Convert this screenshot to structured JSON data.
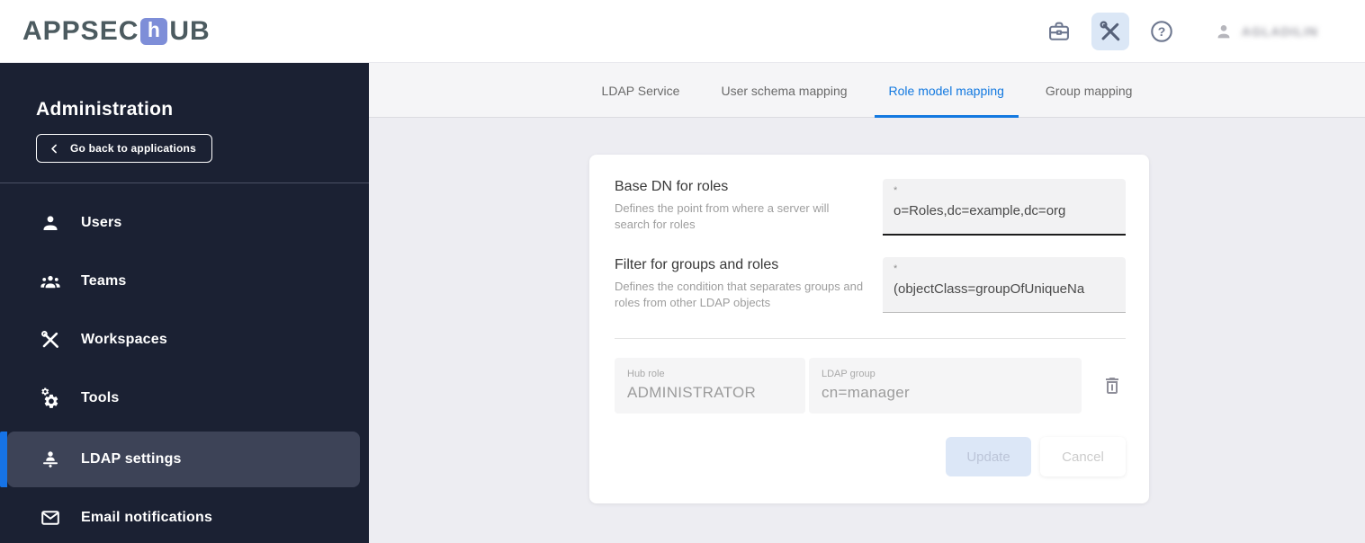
{
  "colors": {
    "accent_blue": "#1379e0",
    "sidebar_bg": "#1b2133",
    "sidebar_selected_bg": "#3d4357",
    "selected_accent_bar": "#1673e6",
    "logo_tile": "#7e8ed8",
    "logo_text": "#4c5b60",
    "page_bg": "#ededf2",
    "tabstrip_bg": "#f5f5f7",
    "input_bg": "#f2f2f3",
    "update_button_bg": "#dce7f7"
  },
  "topbar": {
    "logo": {
      "part1": "APPSEC",
      "tile_letter": "h",
      "part2": "UB"
    },
    "icons": [
      "briefcase-icon",
      "tools-icon",
      "help-icon"
    ],
    "user": {
      "name": "AGLADILIN"
    }
  },
  "sidebar": {
    "title": "Administration",
    "back_button": "Go back to applications",
    "items": [
      {
        "label": "Users",
        "icon": "person-icon",
        "selected": false
      },
      {
        "label": "Teams",
        "icon": "group-icon",
        "selected": false
      },
      {
        "label": "Workspaces",
        "icon": "construction-icon",
        "selected": false
      },
      {
        "label": "Tools",
        "icon": "gears-icon",
        "selected": false
      },
      {
        "label": "LDAP settings",
        "icon": "ldap-person-icon",
        "selected": true
      },
      {
        "label": "Email notifications",
        "icon": "mail-icon",
        "selected": false
      }
    ]
  },
  "tabs": {
    "items": [
      {
        "label": "LDAP Service",
        "active": false
      },
      {
        "label": "User schema mapping",
        "active": false
      },
      {
        "label": "Role model mapping",
        "active": true
      },
      {
        "label": "Group mapping",
        "active": false
      }
    ]
  },
  "form": {
    "fields": [
      {
        "label": "Base DN for roles",
        "description": "Defines the point from where a server will search for roles",
        "required_marker": "*",
        "value": "o=Roles,dc=example,dc=org"
      },
      {
        "label": "Filter for groups and roles",
        "description": "Defines the condition that separates groups and roles from other LDAP objects",
        "required_marker": "*",
        "value": "(objectClass=groupOfUniqueNa"
      }
    ],
    "mapping": {
      "hub_role": {
        "label": "Hub role",
        "value": "ADMINISTRATOR"
      },
      "ldap_group": {
        "label": "LDAP group",
        "value": "cn=manager"
      }
    },
    "actions": {
      "update": "Update",
      "cancel": "Cancel"
    }
  }
}
